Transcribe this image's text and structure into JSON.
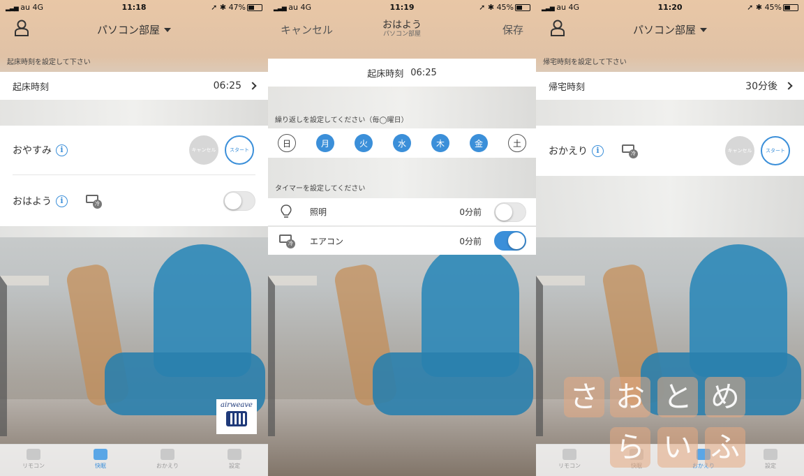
{
  "status": [
    {
      "carrier": "au",
      "net": "4G",
      "time": "11:18",
      "battery": "47%",
      "battery_level": 0.47
    },
    {
      "carrier": "au",
      "net": "4G",
      "time": "11:19",
      "battery": "45%",
      "battery_level": 0.45
    },
    {
      "carrier": "au",
      "net": "4G",
      "time": "11:20",
      "battery": "45%",
      "battery_level": 0.45
    }
  ],
  "screen1": {
    "room": "パソコン部屋",
    "caption": "起床時刻を設定して下さい",
    "row_label": "起床時刻",
    "row_value": "06:25",
    "sleep_label": "おやすみ",
    "cancel": "キャンセル",
    "start": "スタート",
    "wake_label": "おはよう",
    "wake_toggle_on": false
  },
  "screen2": {
    "cancel": "キャンセル",
    "title": "おはよう",
    "subtitle": "パソコン部屋",
    "save": "保存",
    "time_label": "起床時刻",
    "time_value": "06:25",
    "repeat_caption": "繰り返しを設定してください（毎◯曜日）",
    "days": [
      {
        "label": "日",
        "on": false
      },
      {
        "label": "月",
        "on": true
      },
      {
        "label": "火",
        "on": true
      },
      {
        "label": "水",
        "on": true
      },
      {
        "label": "木",
        "on": true
      },
      {
        "label": "金",
        "on": true
      },
      {
        "label": "土",
        "on": false
      }
    ],
    "timer_caption": "タイマーを設定してください",
    "light_label": "照明",
    "light_value": "0分前",
    "light_on": false,
    "ac_label": "エアコン",
    "ac_value": "0分前",
    "ac_on": true,
    "ac_badge": "冷"
  },
  "screen3": {
    "room": "パソコン部屋",
    "caption": "帰宅時刻を設定して下さい",
    "row_label": "帰宅時刻",
    "row_value": "30分後",
    "home_label": "おかえり",
    "cancel": "キャンセル",
    "start": "スタート"
  },
  "tabs": [
    "リモコン",
    "快眠",
    "おかえり",
    "設定"
  ],
  "tab_active": [
    1,
    2
  ],
  "logo_text": "airweave",
  "watermark": [
    "さ",
    "お",
    "と",
    "め",
    "ら",
    "い",
    "ふ"
  ],
  "colors": {
    "accent": "#3b8fd9"
  }
}
